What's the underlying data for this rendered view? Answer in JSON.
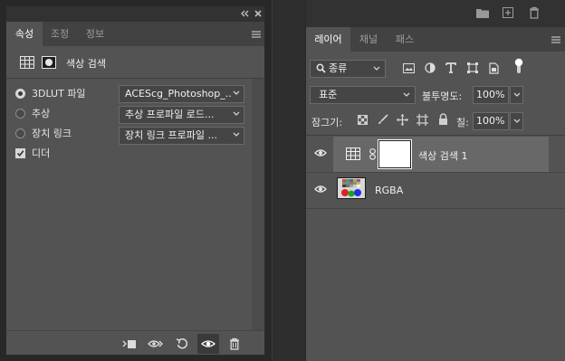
{
  "properties_panel": {
    "tabs": [
      {
        "label": "속성",
        "active": true
      },
      {
        "label": "조정",
        "active": false
      },
      {
        "label": "정보",
        "active": false
      }
    ],
    "header_title": "색상 검색",
    "options": [
      {
        "label": "3DLUT 파일",
        "selected": true,
        "dropdown": "ACEScg_Photoshop_..."
      },
      {
        "label": "추상",
        "selected": false,
        "dropdown": "추상 프로파일 로드..."
      },
      {
        "label": "장치 링크",
        "selected": false,
        "dropdown": "장치 링크 프로파일 ..."
      }
    ],
    "dither": {
      "label": "디더",
      "checked": true
    },
    "footer_icons": [
      "clip-to-layer-icon",
      "view-previous-icon",
      "reset-icon",
      "visibility-icon",
      "trash-icon"
    ]
  },
  "layers_panel": {
    "top_icons": [
      "folder-icon",
      "new-layer-icon",
      "trash-icon"
    ],
    "tabs": [
      {
        "label": "레이어",
        "active": true
      },
      {
        "label": "채널",
        "active": false
      },
      {
        "label": "패스",
        "active": false
      }
    ],
    "filter": {
      "label": "종류"
    },
    "blend_mode": "표준",
    "opacity": {
      "label": "불투명도:",
      "value": "100%"
    },
    "lock_label": "잠그기:",
    "fill": {
      "label": "칠:",
      "value": "100%"
    },
    "layers": [
      {
        "name": "색상 검색 1",
        "selected": true,
        "type": "adjustment"
      },
      {
        "name": "RGBA",
        "selected": false,
        "type": "image"
      }
    ]
  },
  "colors": {
    "panel_bg": "#535353",
    "tab_bg": "#424242",
    "app_bg": "#282828",
    "selected_layer": "#686868"
  }
}
